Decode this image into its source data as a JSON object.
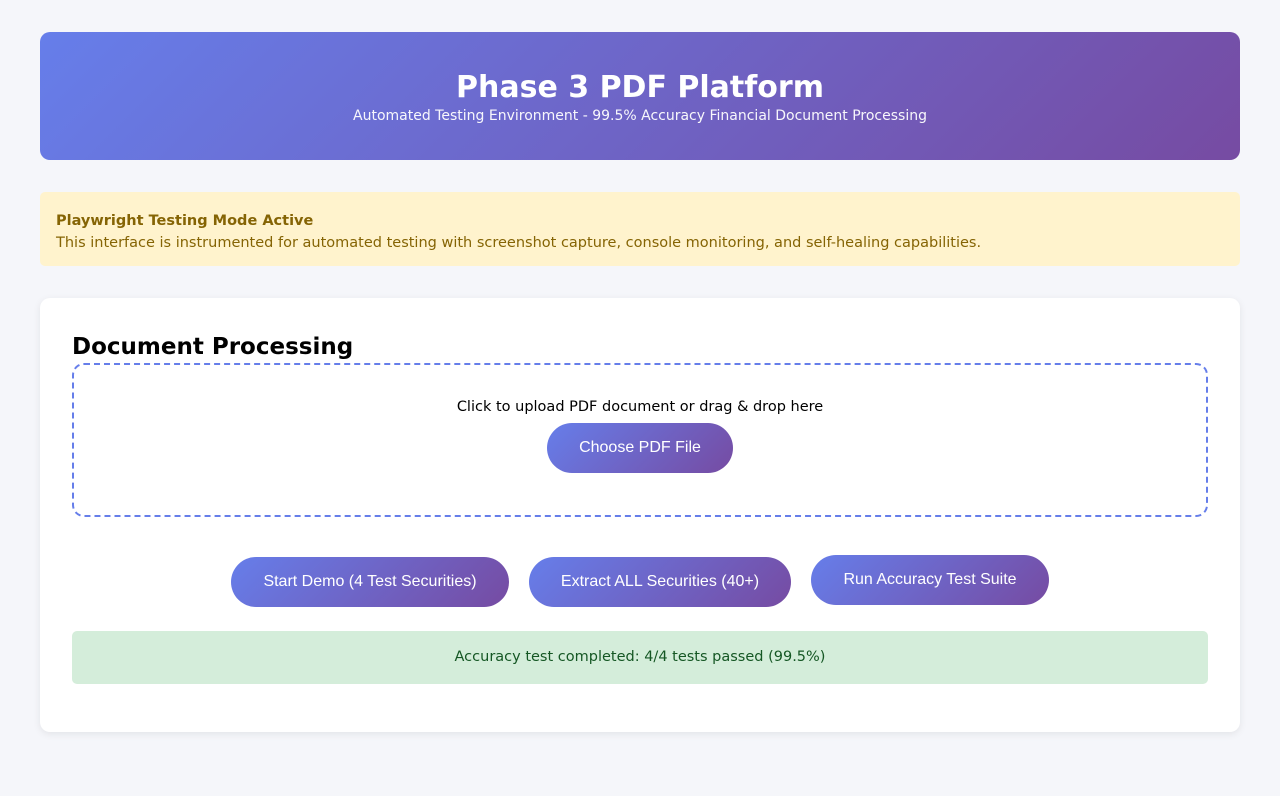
{
  "header": {
    "title": "Phase 3 PDF Platform",
    "subtitle": "Automated Testing Environment - 99.5% Accuracy Financial Document Processing"
  },
  "notice": {
    "title": "Playwright Testing Mode Active",
    "text": "This interface is instrumented for automated testing with screenshot capture, console monitoring, and self-healing capabilities."
  },
  "processing": {
    "heading": "Document Processing",
    "upload_prompt": "Click to upload PDF document or drag & drop here",
    "choose_label": "Choose PDF File",
    "actions": [
      "Start Demo (4 Test Securities)",
      "Extract ALL Securities (40+)",
      "Run Accuracy Test Suite"
    ],
    "status": "Accuracy test completed: 4/4 tests passed (99.5%)"
  }
}
